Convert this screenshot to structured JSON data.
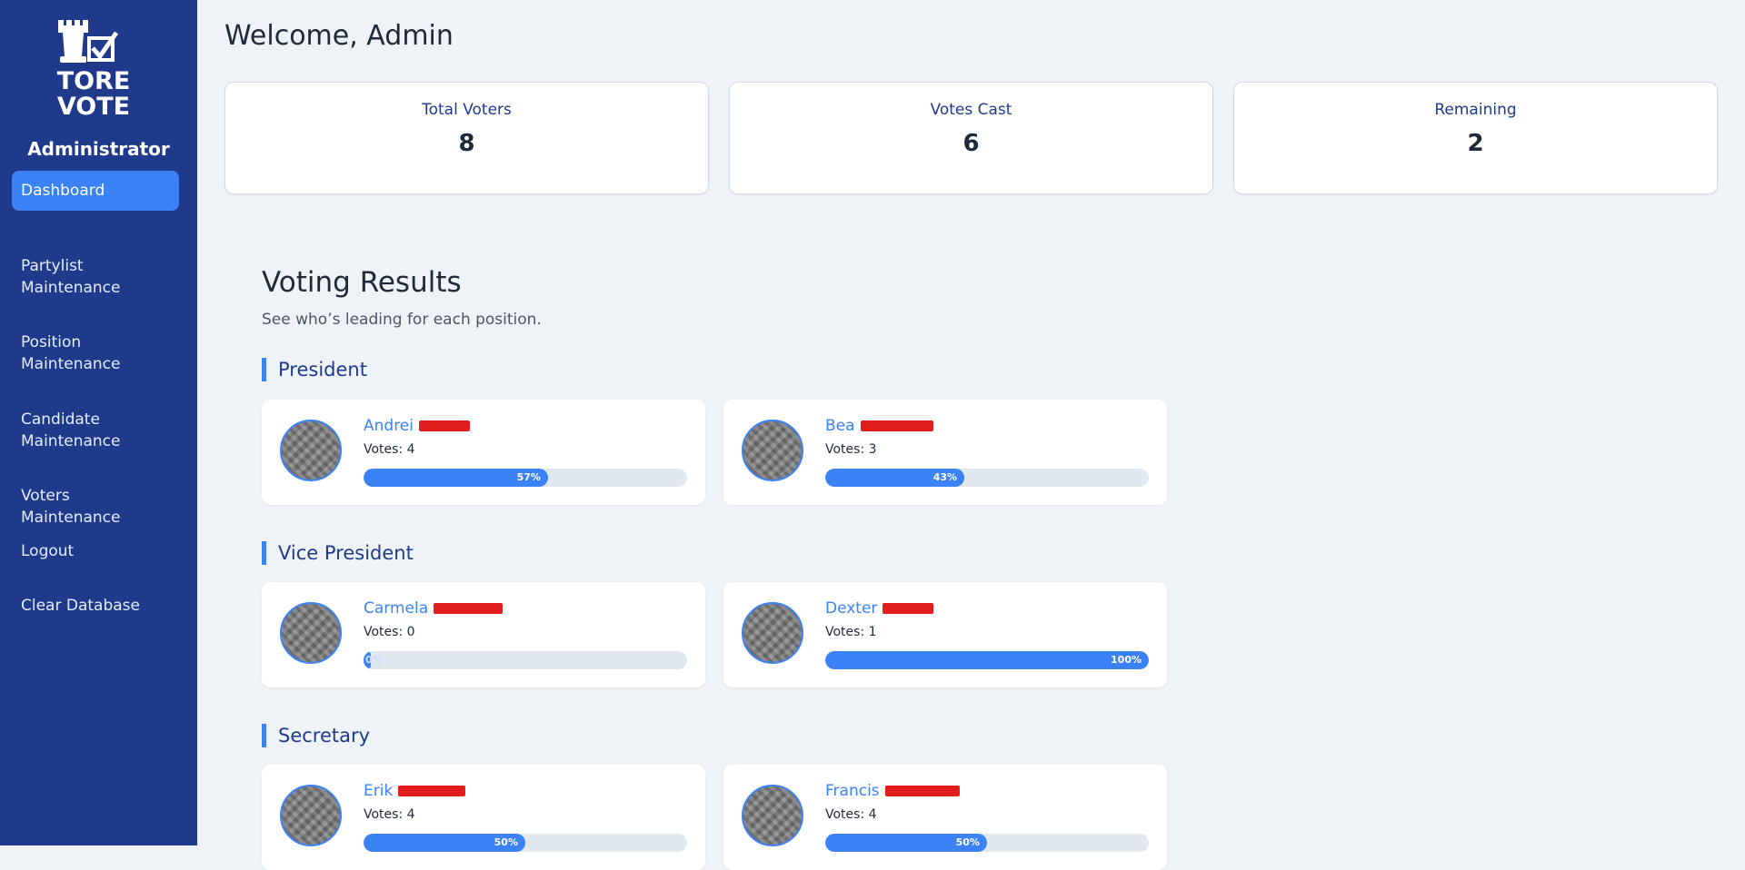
{
  "sidebar": {
    "logo_text_line1": "TORE",
    "logo_text_line2": "VOTE",
    "role": "Administrator",
    "items": [
      {
        "label": "Dashboard",
        "active": true
      },
      {
        "label": "Partylist\nMaintenance",
        "active": false
      },
      {
        "label": "Position\nMaintenance",
        "active": false
      },
      {
        "label": "Candidate\nMaintenance",
        "active": false
      },
      {
        "label": "Voters\nMaintenance",
        "active": false
      },
      {
        "label": "Logout",
        "active": false
      },
      {
        "label": "Clear Database",
        "active": false
      }
    ]
  },
  "header": {
    "title": "Welcome, Admin"
  },
  "stats": [
    {
      "label": "Total Voters",
      "value": "8"
    },
    {
      "label": "Votes Cast",
      "value": "6"
    },
    {
      "label": "Remaining",
      "value": "2"
    }
  ],
  "results": {
    "title": "Voting Results",
    "subtitle": "See who’s leading for each position.",
    "positions": [
      {
        "name": "President",
        "candidates": [
          {
            "first_name": "Andrei",
            "votes_text": "Votes: 4",
            "percent": 57,
            "percent_label": "57%"
          },
          {
            "first_name": "Bea",
            "votes_text": "Votes: 3",
            "percent": 43,
            "percent_label": "43%"
          }
        ]
      },
      {
        "name": "Vice President",
        "candidates": [
          {
            "first_name": "Carmela",
            "votes_text": "Votes: 0",
            "percent": 0,
            "percent_label": "0%"
          },
          {
            "first_name": "Dexter",
            "votes_text": "Votes: 1",
            "percent": 100,
            "percent_label": "100%"
          }
        ]
      },
      {
        "name": "Secretary",
        "candidates": [
          {
            "first_name": "Erik",
            "votes_text": "Votes: 4",
            "percent": 50,
            "percent_label": "50%"
          },
          {
            "first_name": "Francis",
            "votes_text": "Votes: 4",
            "percent": 50,
            "percent_label": "50%"
          }
        ]
      }
    ]
  },
  "colors": {
    "sidebar_bg": "#1f3a8a",
    "accent": "#3b82f6",
    "page_bg": "#eff3f8",
    "redaction": "#e11d1d"
  }
}
